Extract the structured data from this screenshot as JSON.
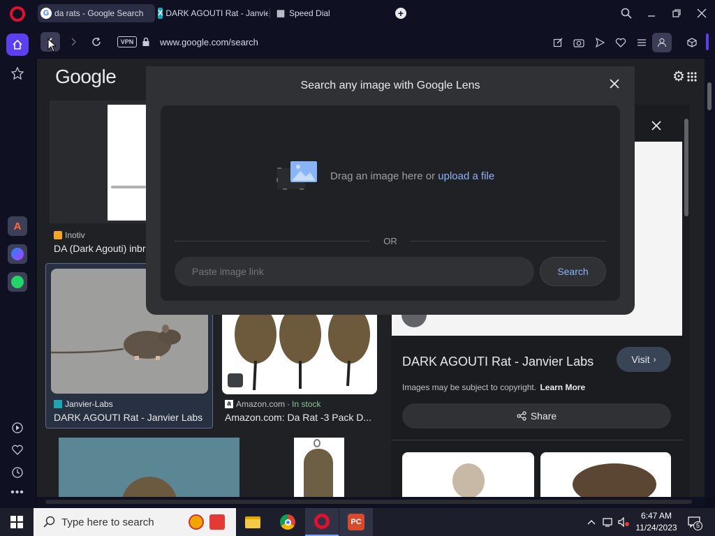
{
  "tabs": [
    {
      "label": "da rats - Google Search",
      "active": true
    },
    {
      "label": "DARK AGOUTI Rat - Janvier",
      "active": false
    },
    {
      "label": "Speed Dial",
      "active": false
    }
  ],
  "address": {
    "vpn": "VPN",
    "url": "www.google.com/search"
  },
  "google": {
    "logo": "Google"
  },
  "results": [
    {
      "source": "Inotiv",
      "title": "DA (Dark Agouti) inbr"
    },
    {
      "source": "Janvier-Labs",
      "title": "DARK AGOUTI Rat - Janvier Labs"
    },
    {
      "source": "Amazon.com",
      "stock": "In stock",
      "title": "Amazon.com: Da Rat -3 Pack D..."
    }
  ],
  "lens": {
    "title": "Search any image with Google Lens",
    "drag_text": "Drag an image here or",
    "upload_link": "upload a file",
    "or_label": "OR",
    "paste_placeholder": "Paste image link",
    "search_button": "Search"
  },
  "preview": {
    "title": "DARK AGOUTI Rat - Janvier Labs",
    "visit": "Visit",
    "copyright": "Images may be subject to copyright.",
    "learn_more": "Learn More",
    "share": "Share"
  },
  "taskbar": {
    "search_placeholder": "Type here to search",
    "time": "6:47 AM",
    "date": "11/24/2023",
    "notifications": "5",
    "pinned": [
      {
        "name": "alarm-clock-app-icon"
      },
      {
        "name": "gift-app-icon"
      },
      {
        "name": "file-explorer-icon"
      },
      {
        "name": "chrome-icon"
      },
      {
        "name": "opera-icon"
      },
      {
        "name": "pc-app-icon"
      }
    ]
  },
  "colors": {
    "accent": "#8ab4f8",
    "opera_red": "#e0102e",
    "sidebar_active": "#5b3ff0"
  }
}
